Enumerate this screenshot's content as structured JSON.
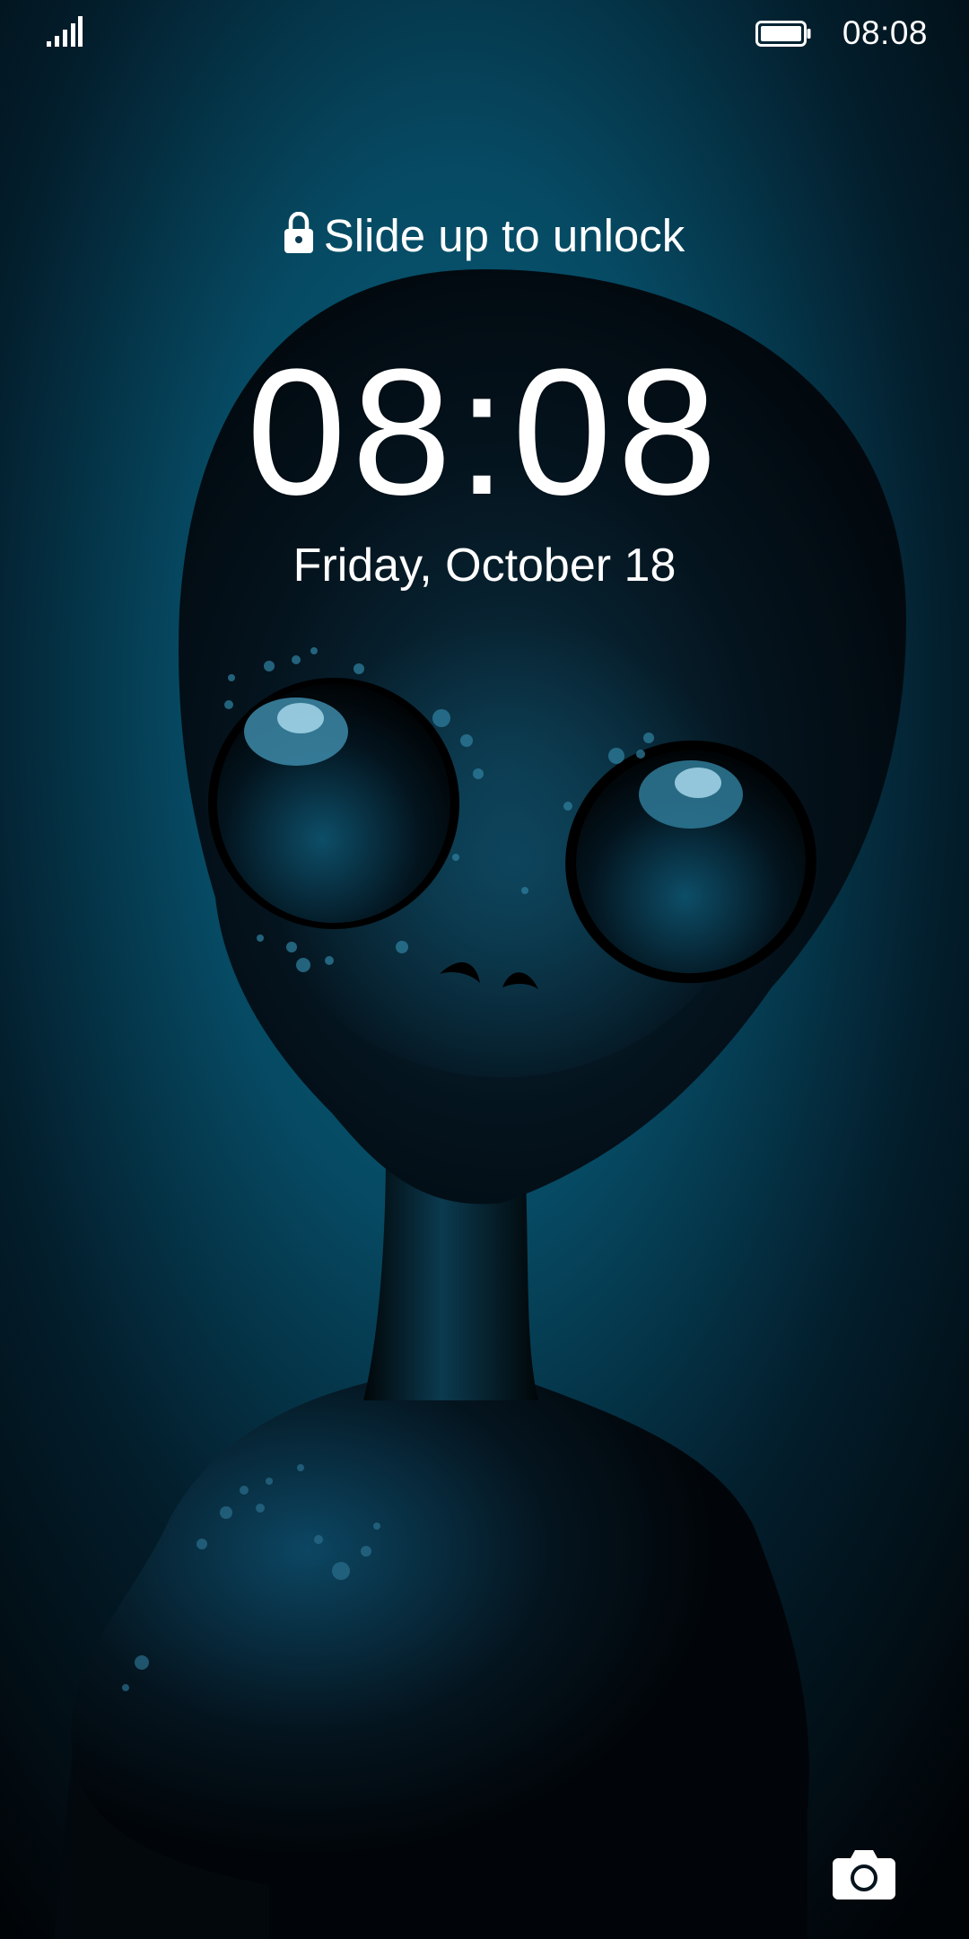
{
  "status_bar": {
    "time": "08:08",
    "signal_icon": "signal-bars-icon",
    "battery_icon": "battery-full-icon"
  },
  "lock_screen": {
    "unlock_hint": "Slide up to unlock",
    "lock_icon": "lock-icon",
    "clock": "08:08",
    "date": "Friday, October 18",
    "camera_icon": "camera-icon"
  },
  "colors": {
    "background_dark": "#02070c",
    "background_glow": "#0a5f78",
    "text": "#ffffff"
  }
}
